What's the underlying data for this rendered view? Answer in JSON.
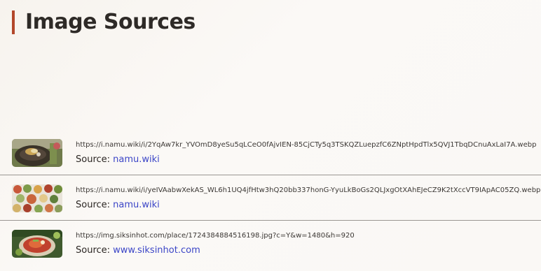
{
  "page": {
    "title": "Image Sources"
  },
  "sources": [
    {
      "url": "https://i.namu.wiki/i/2YqAw7kr_YVOmD8yeSu5qLCeO0fAjvIEN-85CjCTy5q3TSKQZLuepzfC6ZNptHpdTlx5QVJ1TbqDCnuAxLaI7A.webp",
      "source_label": "Source:",
      "source_link": "namu.wiki",
      "thumbnail": "noodle-bowl-thumbnail"
    },
    {
      "url": "https://i.namu.wiki/i/yeIVAabwXekAS_WL6h1UQ4jfHtw3hQ20bb337honG-YyuLkBoGs2QLJxgOtXAhEJeCZ9K2tXccVT9IApAC05ZQ.webp",
      "source_label": "Source:",
      "source_link": "namu.wiki",
      "thumbnail": "side-dishes-thumbnail"
    },
    {
      "url": "https://img.siksinhot.com/place/1724384884516198.jpg?c=Y&w=1480&h=920",
      "source_label": "Source:",
      "source_link": "www.siksinhot.com",
      "thumbnail": "bibim-noodle-thumbnail"
    }
  ],
  "colors": {
    "accent": "#b3472b",
    "link": "#3b45c7"
  }
}
